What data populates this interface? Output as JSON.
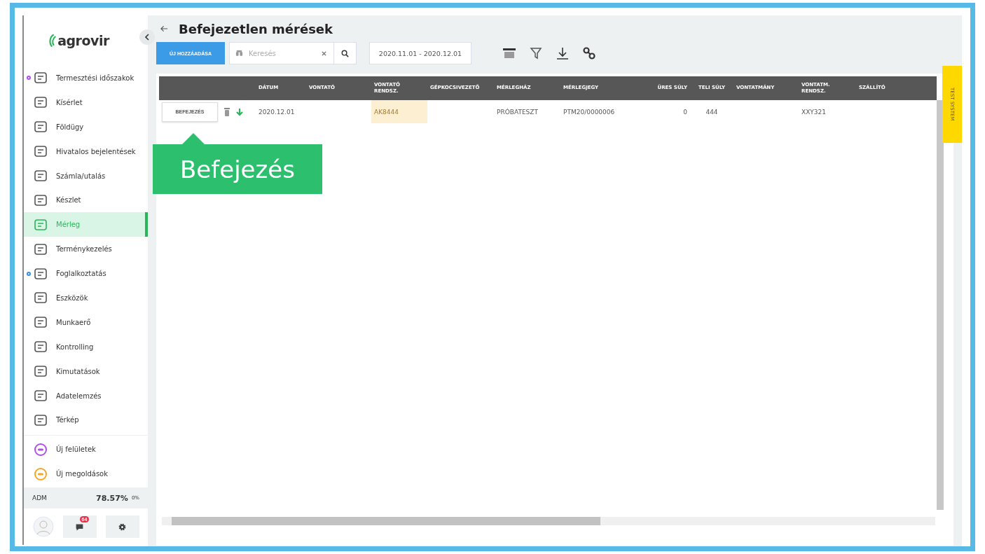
{
  "sidebar": {
    "logo": "agrovir",
    "items": [
      {
        "label": "Termesztési időszakok",
        "selected": false,
        "color": "#b04fe8"
      },
      {
        "label": "Kísérlet",
        "selected": false
      },
      {
        "label": "Földügy",
        "selected": false
      },
      {
        "label": "Hivatalos bejelentések",
        "selected": false
      },
      {
        "label": "Számla/utalás",
        "selected": false
      },
      {
        "label": "Készlet",
        "selected": false
      },
      {
        "label": "Mérleg",
        "selected": true
      },
      {
        "label": "Terménykezelés",
        "selected": false
      },
      {
        "label": "Foglalkoztatás",
        "selected": false,
        "color": "#3a8fd8"
      },
      {
        "label": "Eszközök",
        "selected": false
      },
      {
        "label": "Munkaerő",
        "selected": false
      },
      {
        "label": "Kontrolling",
        "selected": false
      },
      {
        "label": "Kimutatások",
        "selected": false
      },
      {
        "label": "Adatelemzés",
        "selected": false
      },
      {
        "label": "Térkép",
        "selected": false
      }
    ],
    "new_items": [
      {
        "label": "Új felületek",
        "color": "#b04fe8"
      },
      {
        "label": "Új megoldások",
        "color": "#f5a623"
      }
    ],
    "stats": {
      "label": "ADM",
      "percent": "78.57%",
      "small": "0%"
    },
    "chat_badge": "64"
  },
  "page": {
    "title": "Befejezetlen mérések",
    "add_button": "ÚJ HOZZÁADÁSA",
    "search": {
      "placeholder": "Keresés"
    },
    "date_range": "2020.11.01 - 2020.12.01"
  },
  "table": {
    "columns": [
      "DÁTUM",
      "VONTATÓ",
      "VONTATÓ RENDSZ.",
      "GÉPKOCSIVEZETŐ",
      "MÉRLEGHÁZ",
      "MÉRLEGJEGY",
      "ÜRES SÚLY",
      "TELI SÚLY",
      "VONTATMÁNY",
      "VONTATM. RENDSZ.",
      "SZÁLLÍTÓ"
    ],
    "rows": [
      {
        "action": "BEFEJEZÉS",
        "cells": [
          {
            "text": "2020.12.01",
            "highlighted": false
          },
          {
            "text": "",
            "highlighted": false
          },
          {
            "text": "AK8444",
            "highlighted": true
          },
          {
            "text": "",
            "highlighted": false
          },
          {
            "text": "PRÓBATESZT",
            "highlighted": false
          },
          {
            "text": "PTM20/0000006",
            "highlighted": false
          },
          {
            "text": "0",
            "highlighted": false
          },
          {
            "text": "444",
            "highlighted": false
          },
          {
            "text": "",
            "highlighted": false
          },
          {
            "text": "XXY321",
            "highlighted": false
          },
          {
            "text": "",
            "highlighted": false
          }
        ]
      }
    ]
  },
  "tooltip": "Befejezés",
  "test_tab": "TEST SYSTEM"
}
